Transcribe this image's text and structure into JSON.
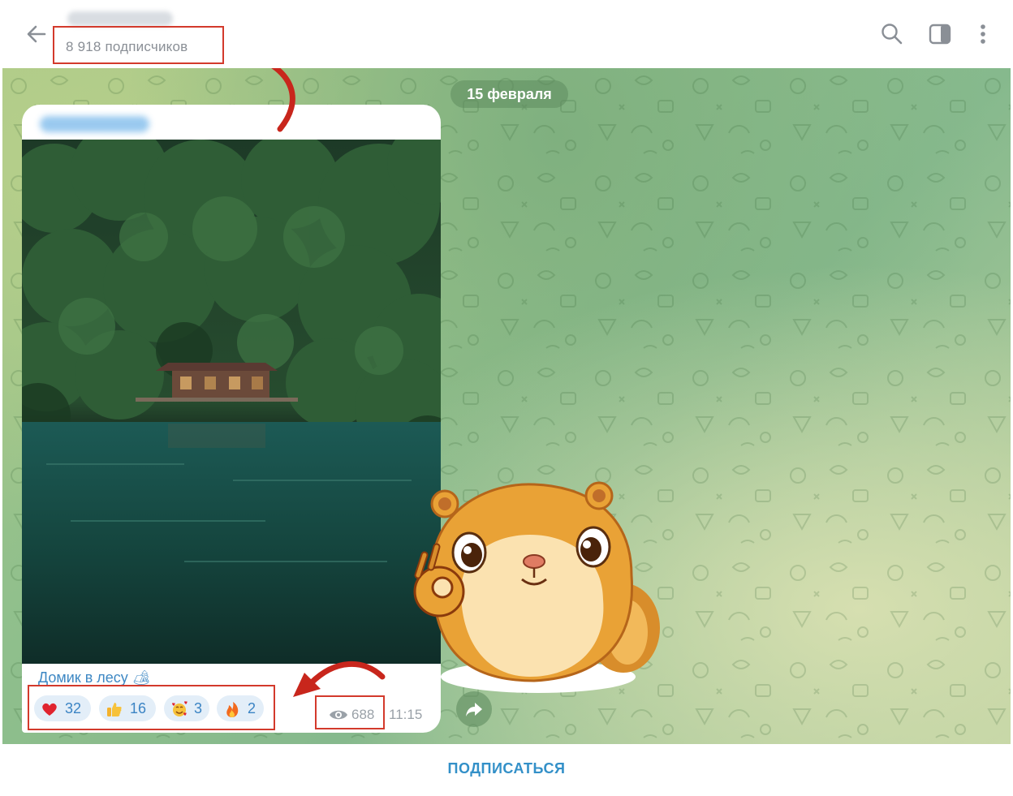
{
  "header": {
    "subscribers": "8 918 подписчиков"
  },
  "chat": {
    "date_pill": "15 февраля"
  },
  "message": {
    "caption": "Домик в лесу 🏕",
    "reactions": [
      {
        "emoji": "heart-icon",
        "count": "32"
      },
      {
        "emoji": "thumbs-up-icon",
        "count": "16"
      },
      {
        "emoji": "smiling-face-with-hearts-icon",
        "count": "3"
      },
      {
        "emoji": "fire-icon",
        "count": "2"
      }
    ],
    "views": "688",
    "time": "11:15"
  },
  "footer": {
    "subscribe_label": "ПОДПИСАТЬСЯ"
  },
  "colors": {
    "accent": "#3390c8",
    "highlight": "#d33a2c",
    "arrow": "#c8261c"
  }
}
